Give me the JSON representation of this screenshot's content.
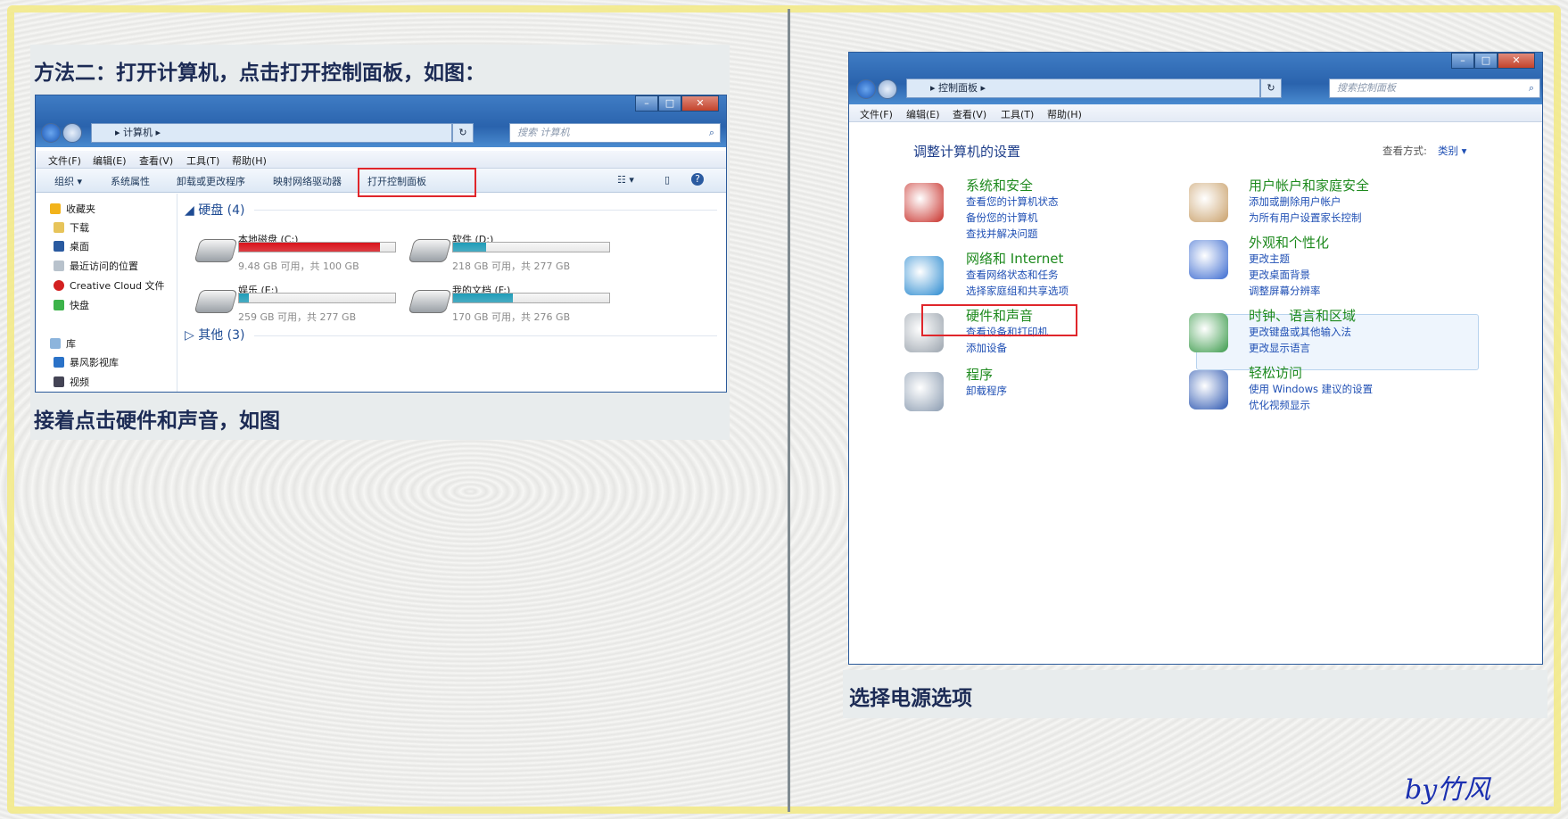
{
  "left": {
    "title": "方法二：打开计算机，点击打开控制面板，如图：",
    "caption": "接着点击硬件和声音，如图",
    "explorer": {
      "address": "计算机",
      "search_placeholder": "搜索 计算机",
      "menu": [
        "文件(F)",
        "编辑(E)",
        "查看(V)",
        "工具(T)",
        "帮助(H)"
      ],
      "toolbar": [
        "组织 ▾",
        "系统属性",
        "卸载或更改程序",
        "映射网络驱动器",
        "打开控制面板"
      ],
      "sidebar": [
        "收藏夹",
        "下载",
        "桌面",
        "最近访问的位置",
        "Creative Cloud 文件",
        "快盘",
        "库",
        "暴风影视库",
        "视频"
      ],
      "group_disks": "硬盘 (4)",
      "group_other": "其他 (3)",
      "drives": [
        {
          "label": "本地磁盘 (C:)",
          "stat": "9.48 GB 可用，共 100 GB",
          "used": 0.905,
          "color": "#d9121a"
        },
        {
          "label": "软件 (D:)",
          "stat": "218 GB 可用，共 277 GB",
          "used": 0.21,
          "color": "#1f9cb8"
        },
        {
          "label": "娱乐 (E:)",
          "stat": "259 GB 可用，共 277 GB",
          "used": 0.065,
          "color": "#1f9cb8"
        },
        {
          "label": "我的文档 (F:)",
          "stat": "170 GB 可用，共 276 GB",
          "used": 0.38,
          "color": "#1f9cb8"
        }
      ]
    }
  },
  "right": {
    "caption": "选择电源选项",
    "control_panel": {
      "address": "控制面板",
      "search_placeholder": "搜索控制面板",
      "menu": [
        "文件(F)",
        "编辑(E)",
        "查看(V)",
        "工具(T)",
        "帮助(H)"
      ],
      "heading": "调整计算机的设置",
      "view_by_label": "查看方式:",
      "view_by_value": "类别 ▾",
      "categories": [
        {
          "title": "系统和安全",
          "links": [
            "查看您的计算机状态",
            "备份您的计算机",
            "查找并解决问题"
          ]
        },
        {
          "title": "网络和 Internet",
          "links": [
            "查看网络状态和任务",
            "选择家庭组和共享选项"
          ]
        },
        {
          "title": "硬件和声音",
          "links": [
            "查看设备和打印机",
            "添加设备"
          ]
        },
        {
          "title": "程序",
          "links": [
            "卸载程序"
          ]
        },
        {
          "title": "用户帐户和家庭安全",
          "links": [
            "添加或删除用户帐户",
            "为所有用户设置家长控制"
          ]
        },
        {
          "title": "外观和个性化",
          "links": [
            "更改主题",
            "更改桌面背景",
            "调整屏幕分辨率"
          ]
        },
        {
          "title": "时钟、语言和区域",
          "links": [
            "更改键盘或其他输入法",
            "更改显示语言"
          ]
        },
        {
          "title": "轻松访问",
          "links": [
            "使用 Windows 建议的设置",
            "优化视频显示"
          ]
        }
      ]
    }
  },
  "signature": "by竹风",
  "colors": {
    "highlight_box": "#e0262b",
    "link": "#1f4fb4",
    "category_title": "#1e8a1e",
    "caption": "#1c2b55"
  }
}
